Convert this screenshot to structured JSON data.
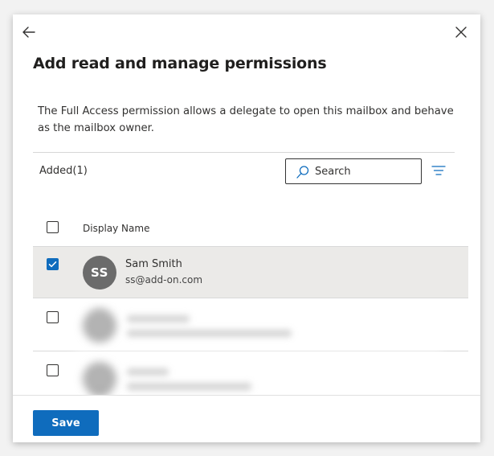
{
  "panel": {
    "title": "Add read and manage permissions",
    "description": "The Full Access permission allows a delegate to open this mailbox and behave as the mailbox owner."
  },
  "toolbar": {
    "added_label": "Added(1)",
    "search_placeholder": "Search"
  },
  "table": {
    "column_header": "Display Name",
    "rows": [
      {
        "initials": "SS",
        "name": "Sam Smith",
        "email": "ss@add-on.com",
        "checked": true
      }
    ]
  },
  "footer": {
    "save_label": "Save"
  },
  "colors": {
    "accent": "#0f6cbd",
    "selected_row": "#ebeae8",
    "avatar": "#6b6b6b"
  },
  "icons": [
    "back-arrow-icon",
    "close-icon",
    "search-icon",
    "filter-icon",
    "checkmark-icon"
  ]
}
